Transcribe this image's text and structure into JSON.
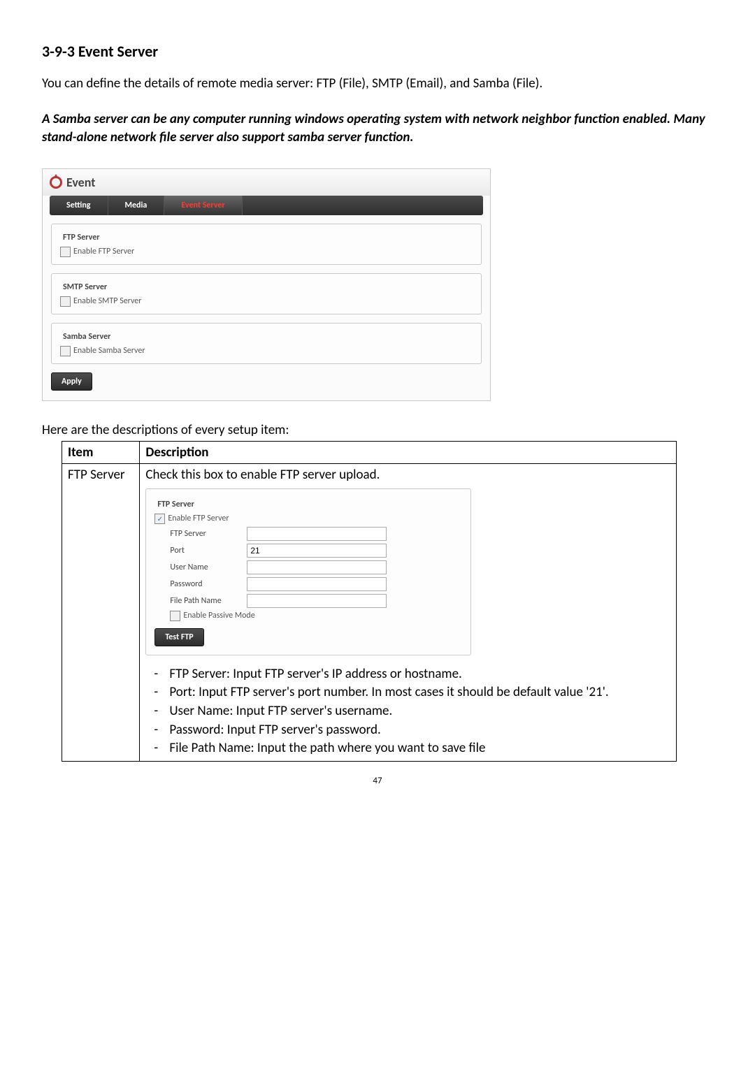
{
  "section": {
    "heading": "3-9-3 Event Server",
    "intro": "You can define the details of remote media server: FTP (File), SMTP (Email), and Samba (File).",
    "emph": "A Samba server can be any computer running windows operating system with network neighbor function enabled. Many stand-alone network file server also support samba server function."
  },
  "panel": {
    "title": "Event",
    "tabs": [
      "Setting",
      "Media",
      "Event Server"
    ],
    "activeTab": "Event Server",
    "groups": [
      {
        "legend": "FTP Server",
        "checkbox": "Enable FTP Server"
      },
      {
        "legend": "SMTP Server",
        "checkbox": "Enable SMTP Server"
      },
      {
        "legend": "Samba Server",
        "checkbox": "Enable Samba Server"
      }
    ],
    "apply": "Apply"
  },
  "descIntro": "Here are the descriptions of every setup item:",
  "table": {
    "headers": [
      "Item",
      "Description"
    ],
    "row": {
      "item": "FTP Server",
      "topDesc": "Check this box to enable FTP server upload.",
      "inner": {
        "legend": "FTP Server",
        "enable": "Enable FTP Server",
        "fields": {
          "ftpserver": {
            "label": "FTP Server",
            "value": ""
          },
          "port": {
            "label": "Port",
            "value": "21"
          },
          "username": {
            "label": "User Name",
            "value": ""
          },
          "password": {
            "label": "Password",
            "value": ""
          },
          "filepath": {
            "label": "File Path Name",
            "value": ""
          }
        },
        "passive": "Enable Passive Mode",
        "testBtn": "Test FTP"
      },
      "bullets": [
        "FTP Server: Input FTP server's IP address or hostname.",
        "Port: Input FTP server's port number. In most cases it should be default value '21'.",
        "User Name: Input FTP server's username.",
        "Password: Input FTP server's password.",
        "File Path Name: Input the path where you want to save file"
      ]
    }
  },
  "pageNumber": "47"
}
